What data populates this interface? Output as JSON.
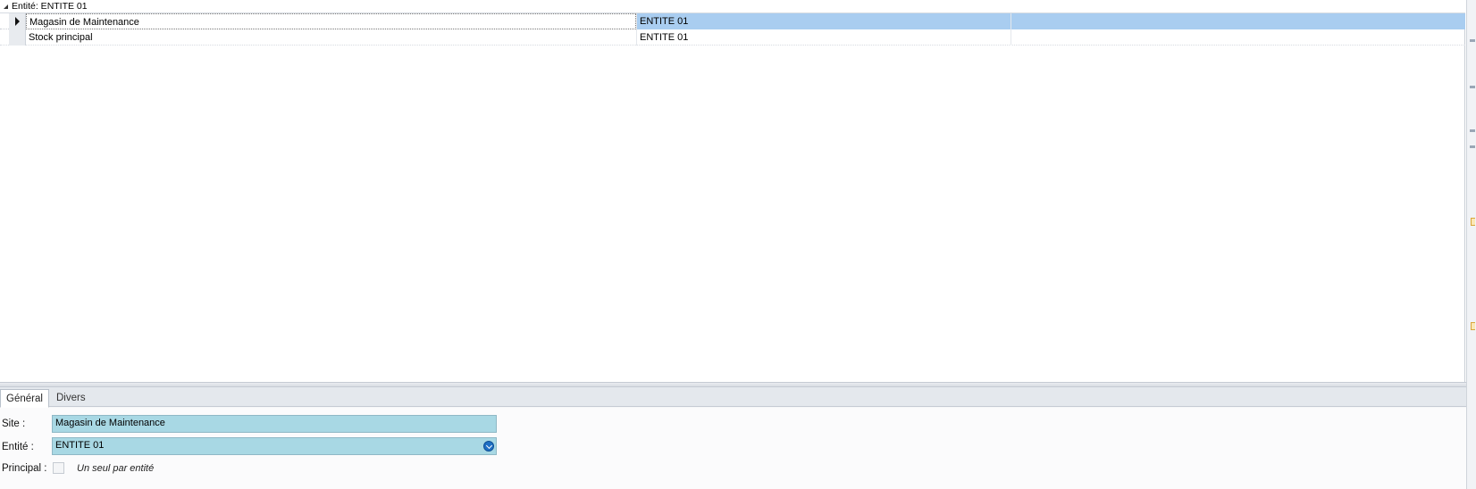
{
  "grid": {
    "group_label": "Entité: ENTITE 01",
    "rows": [
      {
        "site": "Magasin de Maintenance",
        "entite": "ENTITE 01",
        "selected": true
      },
      {
        "site": "Stock principal",
        "entite": "ENTITE 01",
        "selected": false
      }
    ]
  },
  "detail": {
    "tabs": [
      {
        "label": "Général",
        "active": true
      },
      {
        "label": "Divers",
        "active": false
      }
    ],
    "site": {
      "label": "Site :",
      "value": "Magasin de Maintenance"
    },
    "entite": {
      "label": "Entité :",
      "value": "ENTITE 01"
    },
    "principal": {
      "label": "Principal :",
      "checked": false,
      "hint": "Un seul par entité"
    }
  },
  "colors": {
    "selection": "#a9cdf0",
    "field_bg": "#a8d8e4",
    "tabbar": "#e4e8ed"
  }
}
